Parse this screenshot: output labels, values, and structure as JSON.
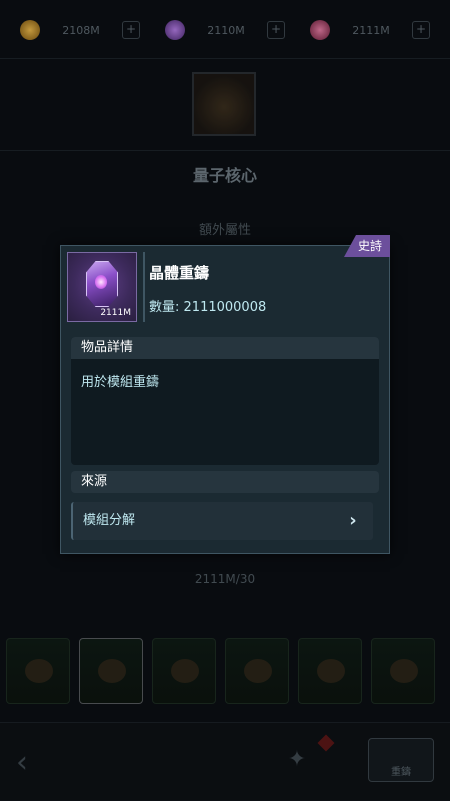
{
  "topbar": {
    "resources": [
      {
        "icon": "gold-coin-icon",
        "amount": "2108M",
        "color": "#c98a1f"
      },
      {
        "icon": "purple-crystal-icon",
        "amount": "2110M",
        "color": "#8a4fc8"
      },
      {
        "icon": "red-gem-icon",
        "amount": "2111M",
        "color": "#c94f7a"
      }
    ],
    "plus": "+"
  },
  "background": {
    "title": "量子核心",
    "extra_attributes": "額外屬性",
    "count": "2111M/30"
  },
  "modal": {
    "rarity": "史詩",
    "item_name": "晶體重鑄",
    "icon_qty": "2111M",
    "quantity_label": "數量:",
    "quantity_value": "2111000008",
    "details_header": "物品詳情",
    "description": "用於模組重鑄",
    "source_header": "來源",
    "source_item": "模組分解"
  },
  "bottombar": {
    "skill_label": "重鑄"
  },
  "colors": {
    "accent_purple": "#6c4f9c",
    "modal_bg": "#1b2a32",
    "text_cyan": "#bfe8f0"
  }
}
